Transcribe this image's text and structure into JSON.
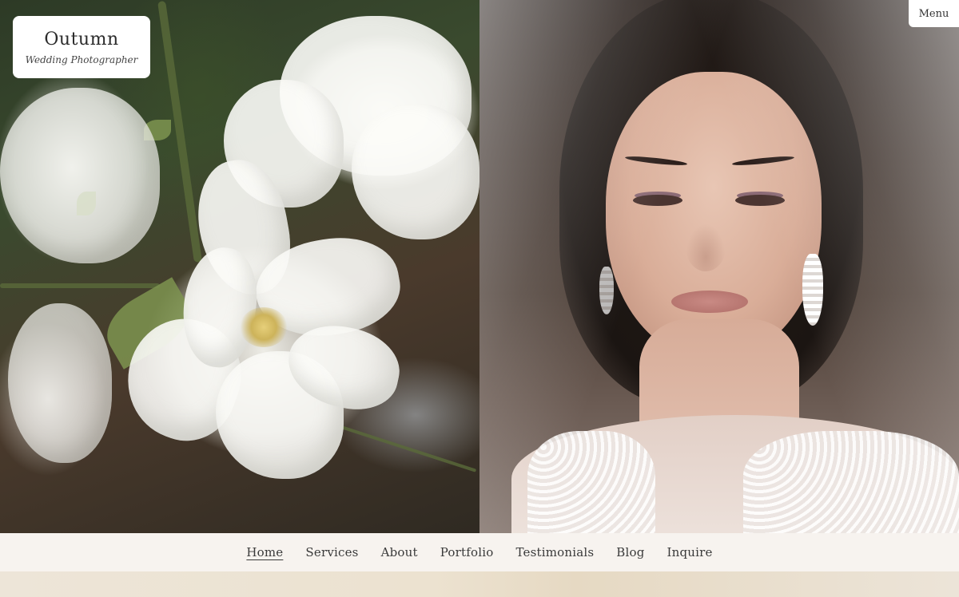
{
  "brand": {
    "title": "Outumn",
    "subtitle": "Wedding Photographer"
  },
  "menu": {
    "label": "Menu"
  },
  "nav": {
    "items": [
      {
        "label": "Home",
        "active": true
      },
      {
        "label": "Services",
        "active": false
      },
      {
        "label": "About",
        "active": false
      },
      {
        "label": "Portfolio",
        "active": false
      },
      {
        "label": "Testimonials",
        "active": false
      },
      {
        "label": "Blog",
        "active": false
      },
      {
        "label": "Inquire",
        "active": false
      }
    ]
  },
  "colors": {
    "nav_background": "#f7f3ef",
    "card_background": "#ffffff",
    "text": "#3a3a3a"
  }
}
